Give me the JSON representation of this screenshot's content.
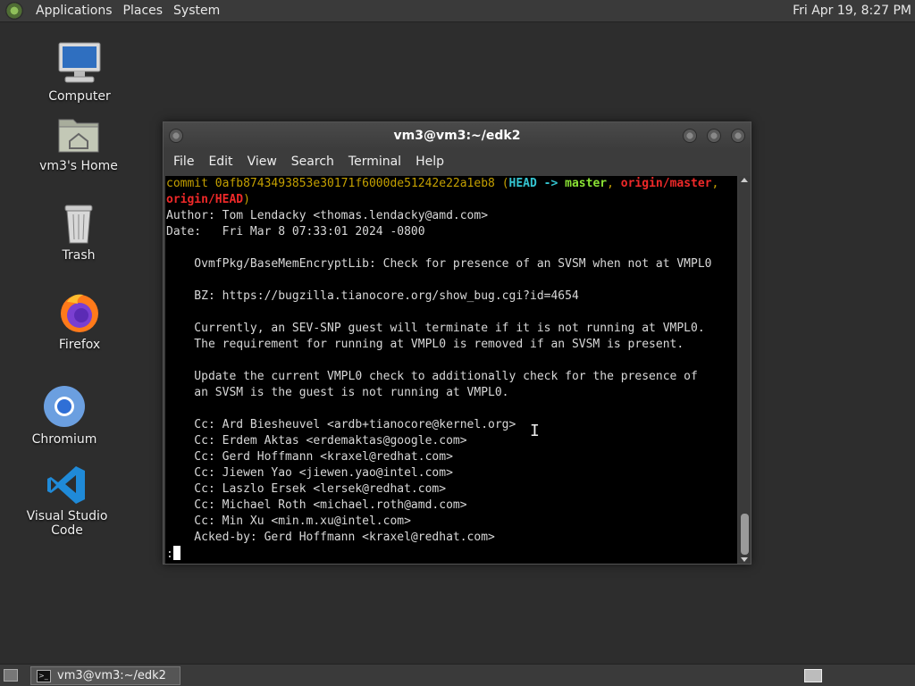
{
  "top_panel": {
    "menus": [
      "Applications",
      "Places",
      "System"
    ],
    "clock": "Fri Apr 19,  8:27 PM"
  },
  "desktop_icons": [
    {
      "label": "Computer",
      "icon": "computer-icon"
    },
    {
      "label": "vm3's Home",
      "icon": "home-folder-icon"
    },
    {
      "label": "Trash",
      "icon": "trash-icon"
    },
    {
      "label": "Firefox",
      "icon": "firefox-icon"
    },
    {
      "label": "Chromium",
      "icon": "chromium-icon"
    },
    {
      "label": "Visual Studio Code",
      "icon": "vscode-icon"
    }
  ],
  "terminal": {
    "title": "vm3@vm3:~/edk2",
    "menus": [
      "File",
      "Edit",
      "View",
      "Search",
      "Terminal",
      "Help"
    ],
    "commit": {
      "keyword": "commit",
      "hash": "0afb8743493853e30171f6000de51242e22a1eb8",
      "head": "HEAD",
      "arrow": "->",
      "branch": "master",
      "origin_master": "origin/master",
      "origin_head": "origin/HEAD"
    },
    "author_line": "Author: Tom Lendacky <thomas.lendacky@amd.com>",
    "date_line": "Date:   Fri Mar 8 07:33:01 2024 -0800",
    "message_lines": [
      "",
      "    OvmfPkg/BaseMemEncryptLib: Check for presence of an SVSM when not at VMPL0",
      "",
      "    BZ: https://bugzilla.tianocore.org/show_bug.cgi?id=4654",
      "",
      "    Currently, an SEV-SNP guest will terminate if it is not running at VMPL0.",
      "    The requirement for running at VMPL0 is removed if an SVSM is present.",
      "",
      "    Update the current VMPL0 check to additionally check for the presence of",
      "    an SVSM is the guest is not running at VMPL0.",
      "",
      "    Cc: Ard Biesheuvel <ardb+tianocore@kernel.org>",
      "    Cc: Erdem Aktas <erdemaktas@google.com>",
      "    Cc: Gerd Hoffmann <kraxel@redhat.com>",
      "    Cc: Jiewen Yao <jiewen.yao@intel.com>",
      "    Cc: Laszlo Ersek <lersek@redhat.com>",
      "    Cc: Michael Roth <michael.roth@amd.com>",
      "    Cc: Min Xu <min.m.xu@intel.com>",
      "    Acked-by: Gerd Hoffmann <kraxel@redhat.com>"
    ],
    "prompt": ":"
  },
  "taskbar": {
    "task_label": "vm3@vm3:~/edk2"
  }
}
